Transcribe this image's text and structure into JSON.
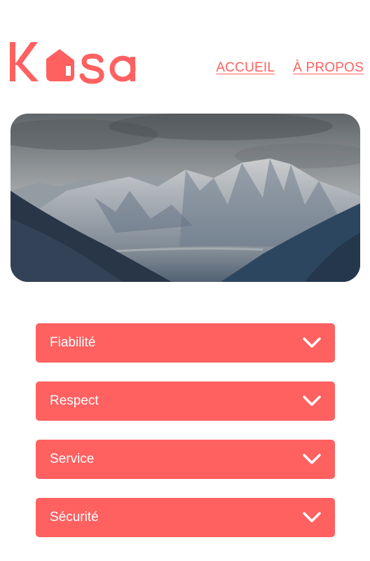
{
  "brand": {
    "logo_text": "Kasa",
    "color": "#ff6060"
  },
  "nav": {
    "items": [
      {
        "label": "ACCUEIL"
      },
      {
        "label": "À PROPOS"
      }
    ]
  },
  "banner": {
    "image": "mountain-landscape"
  },
  "accordion": {
    "items": [
      {
        "label": "Fiabilité",
        "icon": "chevron-down-icon"
      },
      {
        "label": "Respect",
        "icon": "chevron-down-icon"
      },
      {
        "label": "Service",
        "icon": "chevron-down-icon"
      },
      {
        "label": "Sécurité",
        "icon": "chevron-down-icon"
      }
    ]
  }
}
